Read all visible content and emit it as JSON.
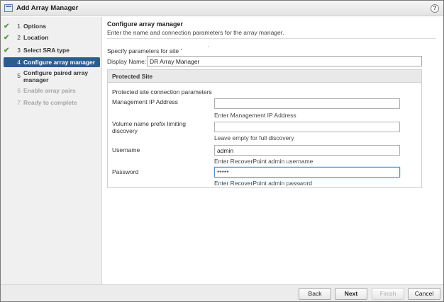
{
  "window": {
    "title": "Add Array Manager",
    "help_glyph": "?"
  },
  "steps": [
    {
      "num": "1",
      "label": "Options",
      "state": "done"
    },
    {
      "num": "2",
      "label": "Location",
      "state": "done"
    },
    {
      "num": "3",
      "label": "Select SRA type",
      "state": "done"
    },
    {
      "num": "4",
      "label": "Configure array manager",
      "state": "active"
    },
    {
      "num": "5",
      "label_line1": "Configure paired array",
      "label_line2": "manager",
      "state": "pending"
    },
    {
      "num": "6",
      "label": "Enable array pairs",
      "state": "disabled"
    },
    {
      "num": "7",
      "label": "Ready to complete",
      "state": "disabled"
    }
  ],
  "check_glyph": "✔",
  "page": {
    "heading": "Configure array manager",
    "subtitle": "Enter the name and connection parameters for the array manager.",
    "specify_label": "Specify parameters for site '",
    "specify_tail": "'",
    "display_name_label": "Display Name:",
    "display_name_value": "DR Array Manager"
  },
  "protected_site": {
    "header": "Protected Site",
    "connection_label": "Protected site connection parameters",
    "mgmt_ip": {
      "label": "Management IP Address",
      "value": "",
      "hint": "Enter Management IP Address"
    },
    "volume_prefix": {
      "label_line1": "Volume name prefix limiting",
      "label_line2": "discovery",
      "value": "",
      "hint": "Leave empty for full discovery"
    },
    "username": {
      "label": "Username",
      "value": "admin",
      "hint": "Enter RecoverPoint admin username"
    },
    "password": {
      "label": "Password",
      "value": "*****",
      "hint": "Enter RecoverPoint admin password"
    }
  },
  "buttons": {
    "back": "Back",
    "next": "Next",
    "finish": "Finish",
    "cancel": "Cancel"
  },
  "colors": {
    "active_step": "#2b5d8f",
    "check": "#4a9a3a",
    "focus_border": "#5b8fc7"
  }
}
